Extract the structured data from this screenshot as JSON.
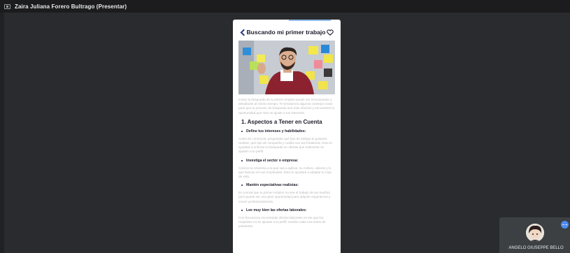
{
  "meeting": {
    "presenter_label": "Zaira Juliana Forero Bultrago (Presentar)"
  },
  "article": {
    "title": "Buscando mi primer trabajo",
    "intro": "Iniciar la búsqueda de tu primer empleo puede ser emocionante y desafiante al mismo tiempo. Te brindamos algunos consejos clave para que tu proceso de búsqueda sea más efectivo y encuentres la oportunidad que más se ajuste a tus intereses.",
    "section_heading": "1. Aspectos a Tener en Cuenta",
    "items": [
      {
        "heading": "Define tus intereses y habilidades:",
        "text": "Antes de comenzar, pregúntate qué tipo de trabajo te gustaría realizar, qué tipo de compañía y cuáles son tus fortalezas. Esto te ayudará a enfocar tu búsqueda en ofertas que realmente se ajusten a tu perfil."
      },
      {
        "heading": "Investiga el sector o empresa:",
        "text": "Conoce la empresa a la que vas a aplicar, su cultura, valores y lo que buscan en sus empleados. Esto te ayudará a adaptar tu hoja de vida."
      },
      {
        "heading": "Mantén expectativas realistas:",
        "text": "Es normal que tu primer empleo no sea el trabajo de tus sueños, pero puede ser una gran oportunidad para adquirir experiencia y crecer profesionalmente."
      },
      {
        "heading": "Lee muy bien las ofertas laborales:",
        "text": "Con frecuencia encontrarás ofertas laborales en las que los requisitos no se ajustan a tu perfil; analiza cada una antes de postularte."
      }
    ]
  },
  "participant": {
    "name": "ANGELO GIUSEPPE BELLO"
  },
  "colors": {
    "accent_blue": "#4d8df6",
    "title_navy": "#2f3a8f"
  }
}
